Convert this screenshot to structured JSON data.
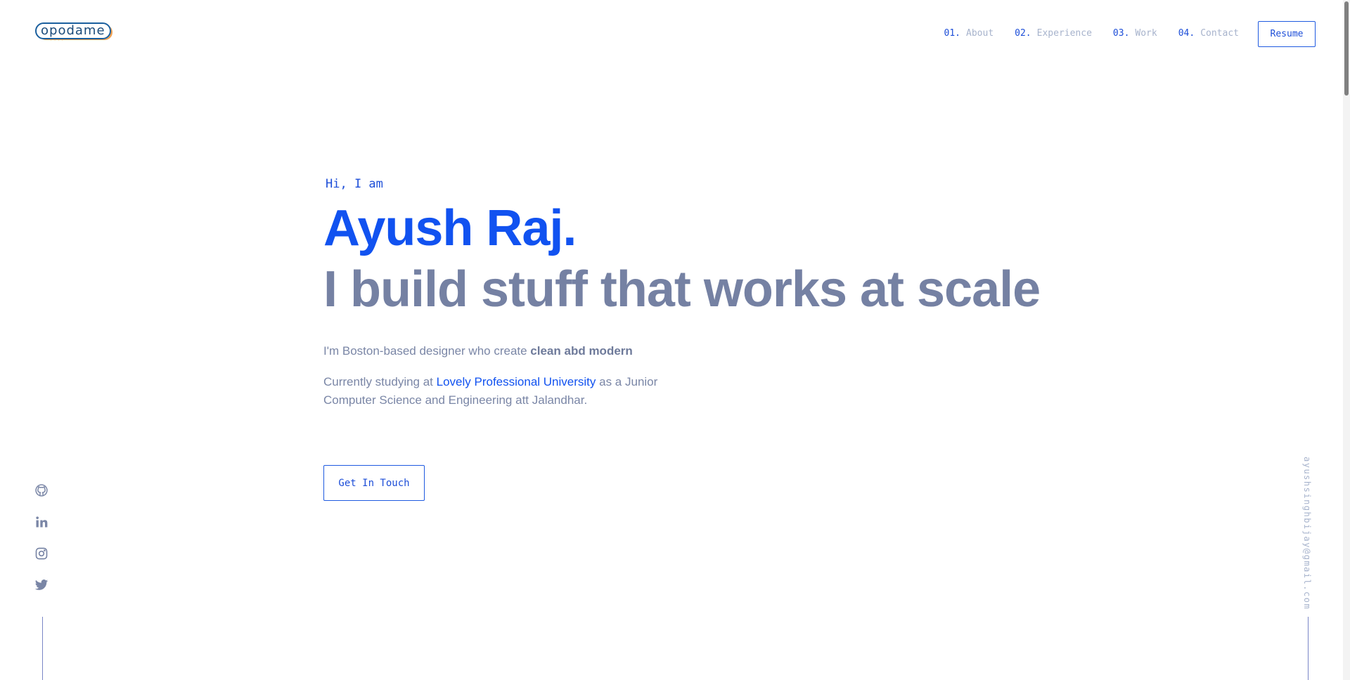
{
  "logo": {
    "word": "opodame",
    "sub": "...."
  },
  "nav": {
    "items": [
      {
        "num": "01.",
        "label": "About"
      },
      {
        "num": "02.",
        "label": "Experience"
      },
      {
        "num": "03.",
        "label": "Work"
      },
      {
        "num": "04.",
        "label": "Contact"
      }
    ],
    "resume_label": "Resume"
  },
  "hero": {
    "greeting": "Hi, I am",
    "name": "Ayush Raj.",
    "tagline": "I build stuff that works at scale",
    "intro_prefix": "I'm Boston-based designer who create ",
    "intro_bold": "clean abd modern",
    "study_prefix": "Currently studying at ",
    "study_link": "Lovely Professional University",
    "study_suffix": " as a Junior Computer Science and Engineering att Jalandhar.",
    "cta_label": "Get In Touch"
  },
  "socials": [
    "github-icon",
    "linkedin-icon",
    "instagram-icon",
    "twitter-icon"
  ],
  "email": "ayushsinghbijay@gmail.com",
  "colors": {
    "accent": "#1152f0",
    "muted": "#7581a3",
    "nav_muted": "#a7b3cc"
  }
}
